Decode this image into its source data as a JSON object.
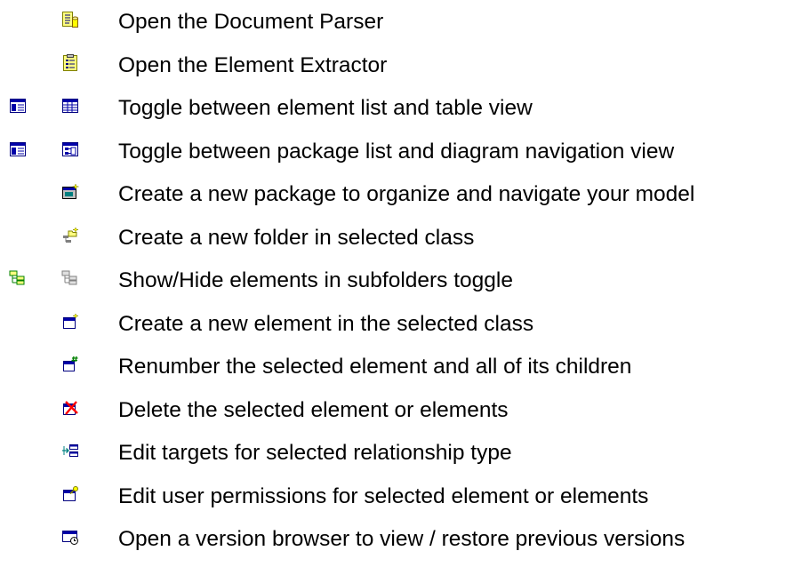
{
  "legend": {
    "items": [
      {
        "label": "Open the Document Parser",
        "icon": "document-parser-icon"
      },
      {
        "label": "Open the Element Extractor",
        "icon": "element-extractor-icon"
      },
      {
        "label": "Toggle between element list and table view",
        "icon": "table-view-icon",
        "alt_icon": "list-view-icon"
      },
      {
        "label": "Toggle between package list and diagram navigation view",
        "icon": "diagram-view-icon",
        "alt_icon": "list-view-icon"
      },
      {
        "label": "Create a new package to organize and navigate your model",
        "icon": "new-package-icon"
      },
      {
        "label": "Create a new folder in selected class",
        "icon": "new-folder-icon"
      },
      {
        "label": "Show/Hide elements in subfolders toggle",
        "icon": "subfolders-hide-icon",
        "alt_icon": "subfolders-show-icon"
      },
      {
        "label": "Create a new element in the selected class",
        "icon": "new-element-icon"
      },
      {
        "label": "Renumber the selected element and all of its children",
        "icon": "renumber-icon"
      },
      {
        "label": "Delete the selected element or elements",
        "icon": "delete-element-icon"
      },
      {
        "label": "Edit targets for selected relationship type",
        "icon": "edit-targets-icon"
      },
      {
        "label": "Edit user permissions for selected element or elements",
        "icon": "permissions-icon"
      },
      {
        "label": "Open a version browser to view / restore previous versions",
        "icon": "version-browser-icon"
      }
    ]
  },
  "colors": {
    "text": "#000000",
    "icon_blue": "#0000a8",
    "icon_yellow": "#ffff00",
    "icon_teal": "#008080",
    "icon_red": "#ff0000"
  }
}
